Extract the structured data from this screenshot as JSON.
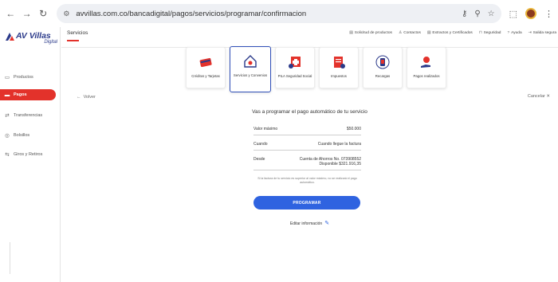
{
  "browser": {
    "url": "avvillas.com.co/bancadigital/pagos/servicios/programar/confirmacion"
  },
  "logo": {
    "brand": "AV Villas",
    "sub": "Digital"
  },
  "sidebar": {
    "items": [
      {
        "label": "Productos",
        "icon": "wallet-icon"
      },
      {
        "label": "Pagos",
        "icon": "card-icon",
        "active": true
      },
      {
        "label": "Transferencias",
        "icon": "transfer-icon"
      },
      {
        "label": "Bolsillos",
        "icon": "pocket-icon"
      },
      {
        "label": "Giros y Retiros",
        "icon": "cash-icon"
      }
    ]
  },
  "topbar": {
    "section": "Servicios",
    "links": [
      {
        "label": "Solicitud de productos",
        "icon": "document-icon"
      },
      {
        "label": "Contactos",
        "icon": "person-icon"
      },
      {
        "label": "Extractos y Certificados",
        "icon": "statement-icon"
      },
      {
        "label": "Seguridad",
        "icon": "lock-icon"
      },
      {
        "label": "Ayuda",
        "icon": "help-icon"
      },
      {
        "label": "Salida segura",
        "icon": "logout-icon"
      }
    ]
  },
  "cards": [
    {
      "label": "Créditos y Tarjetas"
    },
    {
      "label": "Servicios y Convenios"
    },
    {
      "label": "PILA Seguridad Social"
    },
    {
      "label": "Impuestos"
    },
    {
      "label": "Recargas"
    },
    {
      "label": "Pagos realizados"
    }
  ],
  "main": {
    "back": "Volver",
    "cancel": "Cancelar",
    "title": "Vas a programar el pago automático de tu servicio",
    "rows": [
      {
        "key": "Valor máximo",
        "value": "$50.000"
      },
      {
        "key": "Cuando",
        "value": "Cuando llegue la factura"
      },
      {
        "key": "Desde",
        "value": "Cuenta de Ahorros No. 073908552",
        "value2": "Disponible $321.916,35"
      }
    ],
    "note": "Si la factura de tu servicio es superior al valor máximo, no se realizará el pago automático.",
    "button": "PROGRAMAR",
    "edit": "Editar información"
  }
}
